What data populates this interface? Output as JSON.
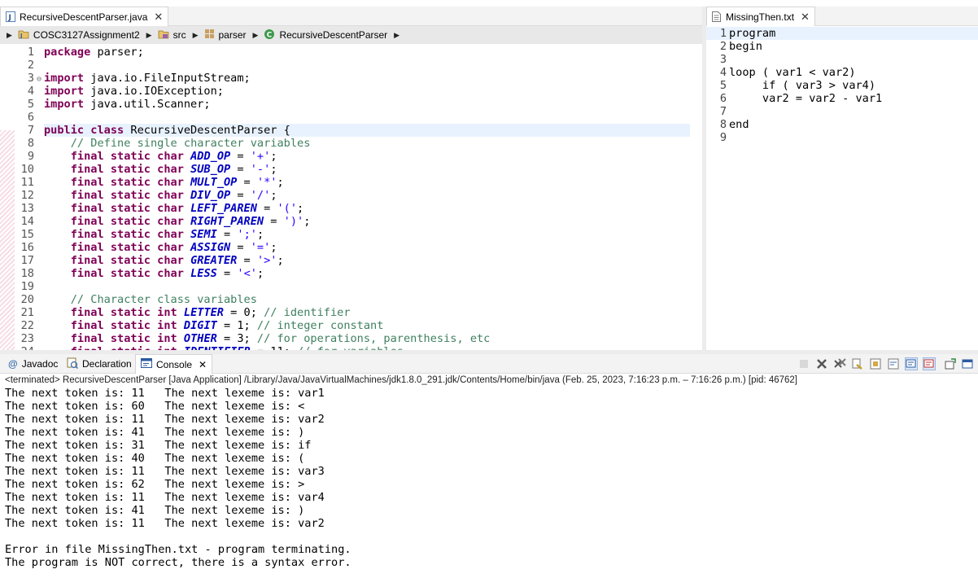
{
  "left_editor": {
    "tab_label": "RecursiveDescentParser.java",
    "breadcrumb": [
      "COSC3127Assignment2",
      "src",
      "parser",
      "RecursiveDescentParser"
    ]
  },
  "right_editor": {
    "tab_label": "MissingThen.txt",
    "lines": [
      {
        "n": "1",
        "text": "program"
      },
      {
        "n": "2",
        "text": "begin"
      },
      {
        "n": "3",
        "text": ""
      },
      {
        "n": "4",
        "text": "loop ( var1 < var2)"
      },
      {
        "n": "5",
        "text": "     if ( var3 > var4)"
      },
      {
        "n": "6",
        "text": "     var2 = var2 - var1"
      },
      {
        "n": "7",
        "text": ""
      },
      {
        "n": "8",
        "text": "end"
      },
      {
        "n": "9",
        "text": ""
      }
    ]
  },
  "code": {
    "l1": {
      "n": "1",
      "kw": "package",
      "rest": " parser;"
    },
    "l2": {
      "n": "2"
    },
    "l3": {
      "n": "3",
      "kw": "import",
      "rest": " java.io.FileInputStream;"
    },
    "l4": {
      "n": "4",
      "kw": "import",
      "rest": " java.io.IOException;"
    },
    "l5": {
      "n": "5",
      "kw": "import",
      "rest": " java.util.Scanner;"
    },
    "l6": {
      "n": "6"
    },
    "l7": {
      "n": "7",
      "kw": "public class",
      "rest": " RecursiveDescentParser {"
    },
    "l8": {
      "n": "8",
      "comment": "// Define single character variables"
    },
    "char_fields": [
      {
        "n": "9",
        "name": "ADD_OP",
        "val": "'+'"
      },
      {
        "n": "10",
        "name": "SUB_OP",
        "val": "'-'"
      },
      {
        "n": "11",
        "name": "MULT_OP",
        "val": "'*'"
      },
      {
        "n": "12",
        "name": "DIV_OP",
        "val": "'/'"
      },
      {
        "n": "13",
        "name": "LEFT_PAREN",
        "val": "'('"
      },
      {
        "n": "14",
        "name": "RIGHT_PAREN",
        "val": "')'"
      },
      {
        "n": "15",
        "name": "SEMI",
        "val": "';'"
      },
      {
        "n": "16",
        "name": "ASSIGN",
        "val": "'='"
      },
      {
        "n": "17",
        "name": "GREATER",
        "val": "'>'"
      },
      {
        "n": "18",
        "name": "LESS",
        "val": "'<'"
      }
    ],
    "char_kw": "final static char",
    "l19": {
      "n": "19"
    },
    "l20": {
      "n": "20",
      "comment": "// Character class variables"
    },
    "int_kw": "final static int",
    "int_fields": [
      {
        "n": "21",
        "name": "LETTER",
        "val": " = 0; ",
        "comment": "// identifier"
      },
      {
        "n": "22",
        "name": "DIGIT",
        "val": " = 1; ",
        "comment": "// integer constant"
      },
      {
        "n": "23",
        "name": "OTHER",
        "val": " = 3; ",
        "comment": "// for operations, parenthesis, etc"
      }
    ]
  },
  "console": {
    "tabs": {
      "javadoc": "Javadoc",
      "declaration": "Declaration",
      "console": "Console"
    },
    "terminated": "<terminated> RecursiveDescentParser [Java Application] /Library/Java/JavaVirtualMachines/jdk1.8.0_291.jdk/Contents/Home/bin/java  (Feb. 25, 2023, 7:16:23 p.m. – 7:16:26 p.m.) [pid: 46762]",
    "output": [
      "The next token is: 11   The next lexeme is: var1",
      "The next token is: 60   The next lexeme is: <",
      "The next token is: 11   The next lexeme is: var2",
      "The next token is: 41   The next lexeme is: )",
      "The next token is: 31   The next lexeme is: if",
      "The next token is: 40   The next lexeme is: (",
      "The next token is: 11   The next lexeme is: var3",
      "The next token is: 62   The next lexeme is: >",
      "The next token is: 11   The next lexeme is: var4",
      "The next token is: 41   The next lexeme is: )",
      "The next token is: 11   The next lexeme is: var2",
      "",
      "Error in file MissingThen.txt - program terminating.",
      "The program is NOT correct, there is a syntax error."
    ]
  }
}
